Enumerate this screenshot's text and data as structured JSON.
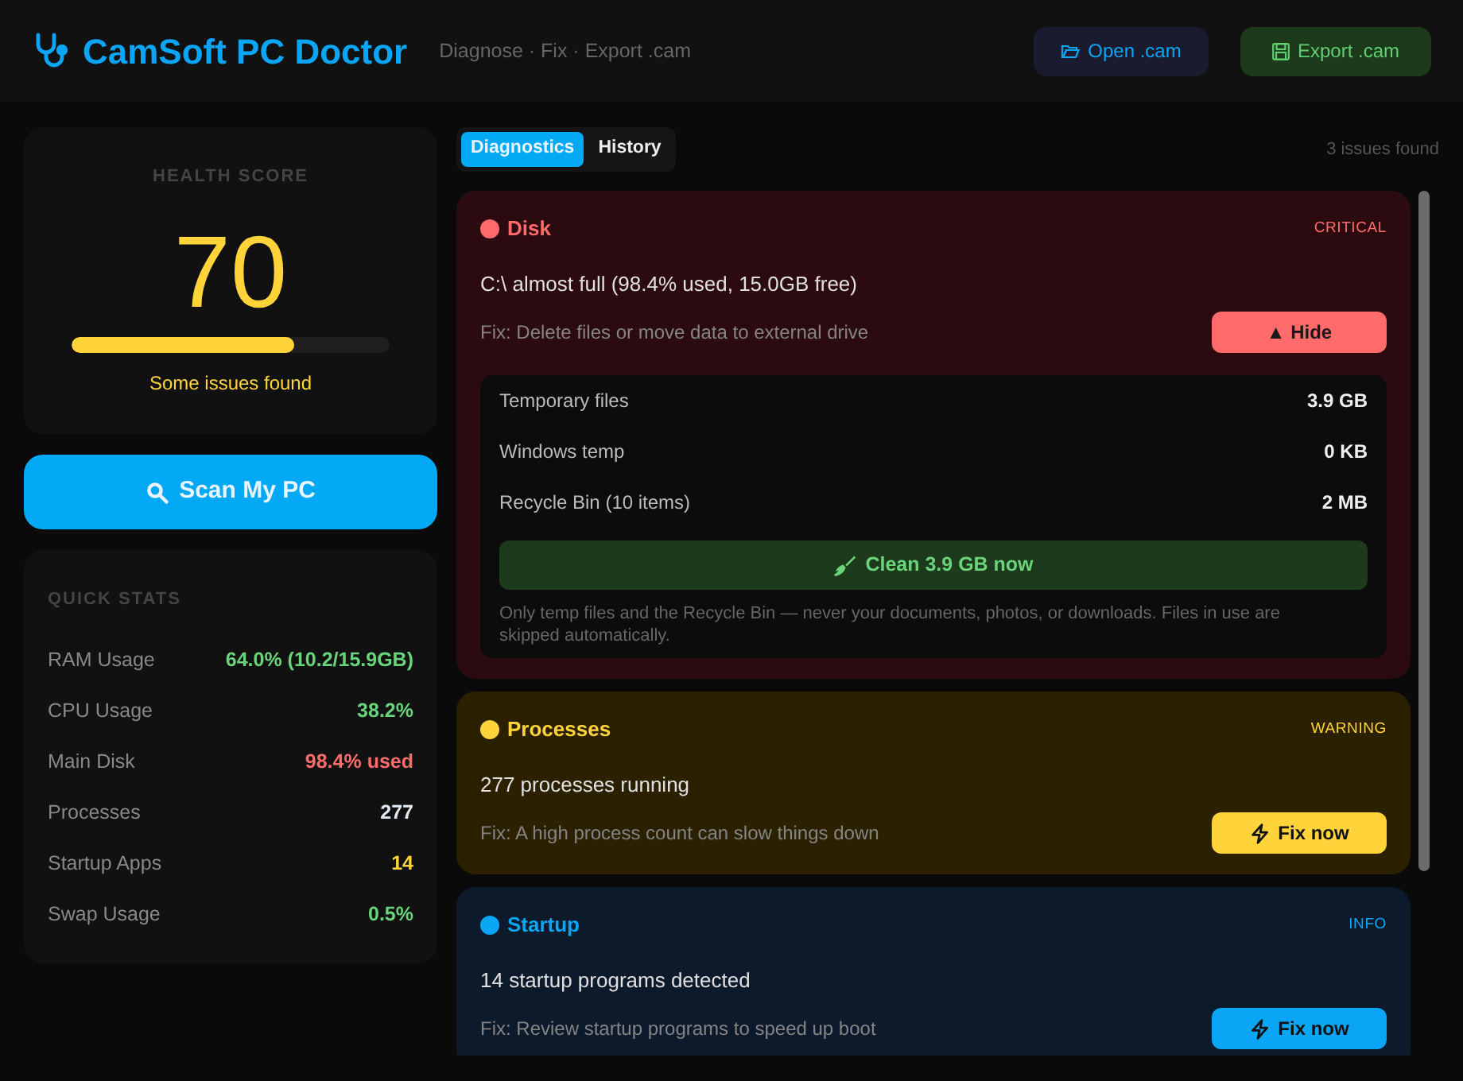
{
  "header": {
    "title": "CamSoft PC Doctor",
    "subtitle": "Diagnose · Fix · Export .cam",
    "buttons": [
      {
        "kind": "open",
        "label": "Open .cam"
      },
      {
        "kind": "export",
        "label": "Export .cam"
      }
    ]
  },
  "health": {
    "label": "HEALTH SCORE",
    "score": "70",
    "level": 0.7,
    "status": "Some issues found"
  },
  "scan_button": {
    "label": "Scan My PC"
  },
  "quick_stats": {
    "title": "QUICK STATS",
    "rows": [
      {
        "label": "RAM Usage",
        "value": "64.0% (10.2/15.9GB)",
        "color": "#69d47a"
      },
      {
        "label": "CPU Usage",
        "value": "38.2%",
        "color": "#69d47a"
      },
      {
        "label": "Main Disk",
        "value": "98.4% used",
        "color": "#ff6b6b"
      },
      {
        "label": "Processes",
        "value": "277",
        "color": "#e2e8f0"
      },
      {
        "label": "Startup Apps",
        "value": "14",
        "color": "#ffd43b"
      },
      {
        "label": "Swap Usage",
        "value": "0.5%",
        "color": "#69d47a"
      }
    ]
  },
  "tabs": [
    {
      "label": "Diagnostics",
      "selected": true
    },
    {
      "label": "History",
      "selected": false
    }
  ],
  "issue_count": "3 issues found",
  "issues": [
    {
      "kind": "critical",
      "severity_label": "CRITICAL",
      "color": "#ff6b6b",
      "title": "Disk",
      "message": "C:\\ almost full (98.4% used, 15.0GB free)",
      "fix": "Fix: Delete files or move data to external drive",
      "action": {
        "kind": "toggle",
        "label": "▲ Hide"
      },
      "expanded": true,
      "details": {
        "rows": [
          {
            "label": "Temporary files",
            "value": "3.9 GB"
          },
          {
            "label": "Windows temp",
            "value": "0 KB"
          },
          {
            "label": "Recycle Bin (10 items)",
            "value": "2 MB"
          }
        ],
        "clean_button": "Clean 3.9 GB now",
        "note": "Only temp files and the Recycle Bin — never your documents, photos, or downloads. Files in use are skipped automatically."
      }
    },
    {
      "kind": "warning",
      "severity_label": "WARNING",
      "color": "#ffd43b",
      "title": "Processes",
      "message": "277 processes running",
      "fix": "Fix: A high process count can slow things down",
      "action": {
        "kind": "fix",
        "label": "Fix now"
      }
    },
    {
      "kind": "info",
      "severity_label": "INFO",
      "color": "#0aa6f5",
      "title": "Startup",
      "message": "14 startup programs detected",
      "fix": "Fix: Review startup programs to speed up boot",
      "action": {
        "kind": "fix",
        "label": "Fix now"
      }
    }
  ]
}
